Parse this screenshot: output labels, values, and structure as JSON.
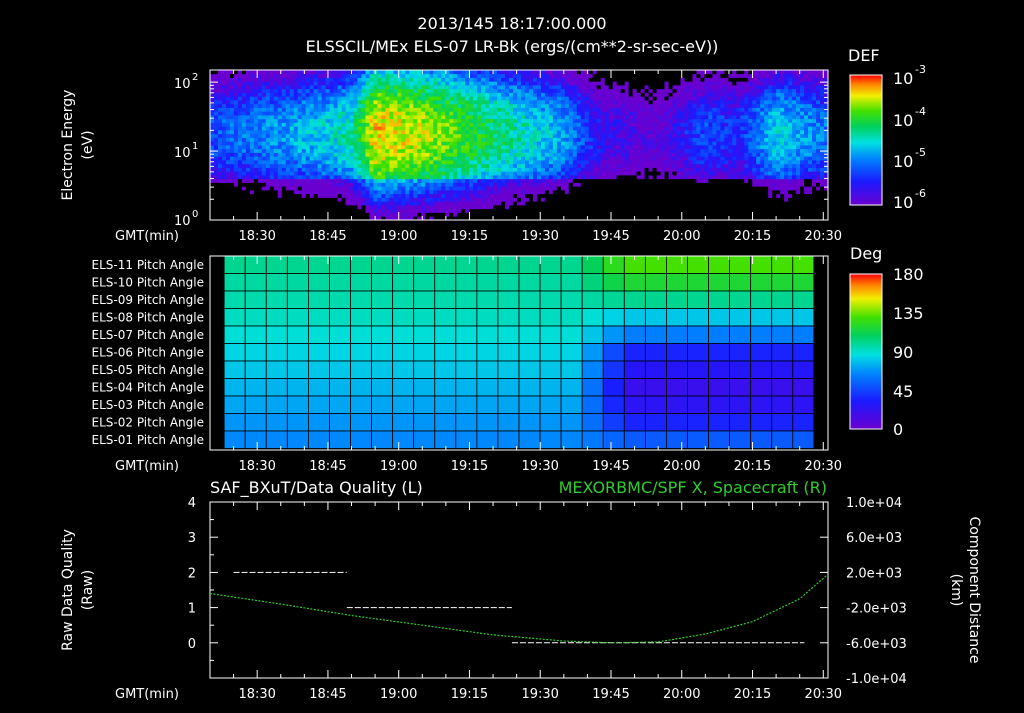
{
  "header": {
    "timestamp": "2013/145 18:17:00.000",
    "subtitle": "ELSSCIL/MEx ELS-07 LR-Bk  (ergs/(cm**2-sr-sec-eV))"
  },
  "time_axis": {
    "label": "GMT(min)",
    "ticks": [
      "18:30",
      "18:45",
      "19:00",
      "19:15",
      "19:30",
      "19:45",
      "20:00",
      "20:15",
      "20:30"
    ]
  },
  "colors": {
    "background": "#000000",
    "axes": "#ffffff",
    "grid_lines": "#000000",
    "spacecraft_series": "#2ecc2e",
    "quality_series": "#ffffff"
  },
  "chart_data": [
    {
      "type": "heatmap",
      "title": "ELSSCIL/MEx ELS-07 LR-Bk  (ergs/(cm**2-sr-sec-eV))",
      "ylabel_line1": "Electron Energy",
      "ylabel_line2": "(eV)",
      "xlabel": "GMT(min)",
      "y_scale": "log",
      "ylim": [
        1,
        150
      ],
      "y_ticks": [
        {
          "base": "10",
          "exp": "2"
        },
        {
          "base": "10",
          "exp": "1"
        },
        {
          "base": "10",
          "exp": "0"
        }
      ],
      "colorbar": {
        "title": "DEF",
        "scale": "log",
        "range": [
          1e-06,
          0.001
        ],
        "ticks": [
          {
            "base": "10",
            "exp": "-3"
          },
          {
            "base": "10",
            "exp": "-4"
          },
          {
            "base": "10",
            "exp": "-5"
          },
          {
            "base": "10",
            "exp": "-6"
          }
        ]
      },
      "time_range_min": [
        "18:20",
        "20:31"
      ],
      "energy_profile_estimate": {
        "x": [
          "18:20",
          "18:45",
          "18:50",
          "18:55",
          "19:05",
          "19:20",
          "19:35",
          "19:43",
          "19:55",
          "20:05",
          "20:12",
          "20:20",
          "20:30"
        ],
        "peak_log10_def": [
          -5.2,
          -4.6,
          -4.4,
          -3.4,
          -3.6,
          -4.2,
          -4.8,
          -5.6,
          -5.9,
          -5.2,
          -5.4,
          -4.6,
          -5.0
        ]
      }
    },
    {
      "type": "heatmap",
      "xlabel": "GMT(min)",
      "rows": [
        "ELS-11 Pitch Angle",
        "ELS-10 Pitch Angle",
        "ELS-09 Pitch Angle",
        "ELS-08 Pitch Angle",
        "ELS-07 Pitch Angle",
        "ELS-06 Pitch Angle",
        "ELS-05 Pitch Angle",
        "ELS-04 Pitch Angle",
        "ELS-03 Pitch Angle",
        "ELS-02 Pitch Angle",
        "ELS-01 Pitch Angle"
      ],
      "colorbar": {
        "title": "Deg",
        "range": [
          0,
          180
        ],
        "ticks": [
          "180",
          "135",
          "90",
          "45",
          "0"
        ]
      },
      "time_range_min": [
        "18:23",
        "20:28"
      ],
      "pitch_angle_deg_before_19_40": [
        100,
        97,
        95,
        92,
        88,
        84,
        80,
        76,
        72,
        68,
        65
      ],
      "pitch_angle_deg_after_19_50": [
        130,
        118,
        100,
        80,
        62,
        35,
        28,
        20,
        25,
        35,
        52
      ]
    },
    {
      "type": "line",
      "title_left": "SAF_BXuT/Data Quality (L)",
      "title_right": "MEXORBMC/SPF X, Spacecraft (R)",
      "ylabel_left_line1": "Raw Data Quality",
      "ylabel_left_line2": "(Raw)",
      "ylabel_right_line1": "Component Distance",
      "ylabel_right_line2": "(km)",
      "xlabel": "GMT(min)",
      "ylim_left": [
        -1,
        4
      ],
      "y_ticks_left": [
        "4",
        "3",
        "2",
        "1",
        "0"
      ],
      "ylim_right": [
        -10000,
        10000
      ],
      "y_ticks_right": [
        "1.0e+04",
        "6.0e+03",
        "2.0e+03",
        "-2.0e+03",
        "-6.0e+03",
        "-1.0e+04"
      ],
      "series": [
        {
          "axis": "left",
          "x": [
            "18:25",
            "18:49",
            "18:49",
            "19:24",
            "19:24",
            "20:26"
          ],
          "y": [
            2,
            2,
            1,
            1,
            0,
            0
          ]
        },
        {
          "axis": "right",
          "x": [
            "18:20",
            "18:35",
            "18:50",
            "19:05",
            "19:20",
            "19:35",
            "19:45",
            "19:55",
            "20:05",
            "20:15",
            "20:25",
            "20:31"
          ],
          "y": [
            -400,
            -1600,
            -2900,
            -4000,
            -5100,
            -5800,
            -6000,
            -5900,
            -5000,
            -3600,
            -1000,
            1800
          ]
        }
      ]
    }
  ]
}
